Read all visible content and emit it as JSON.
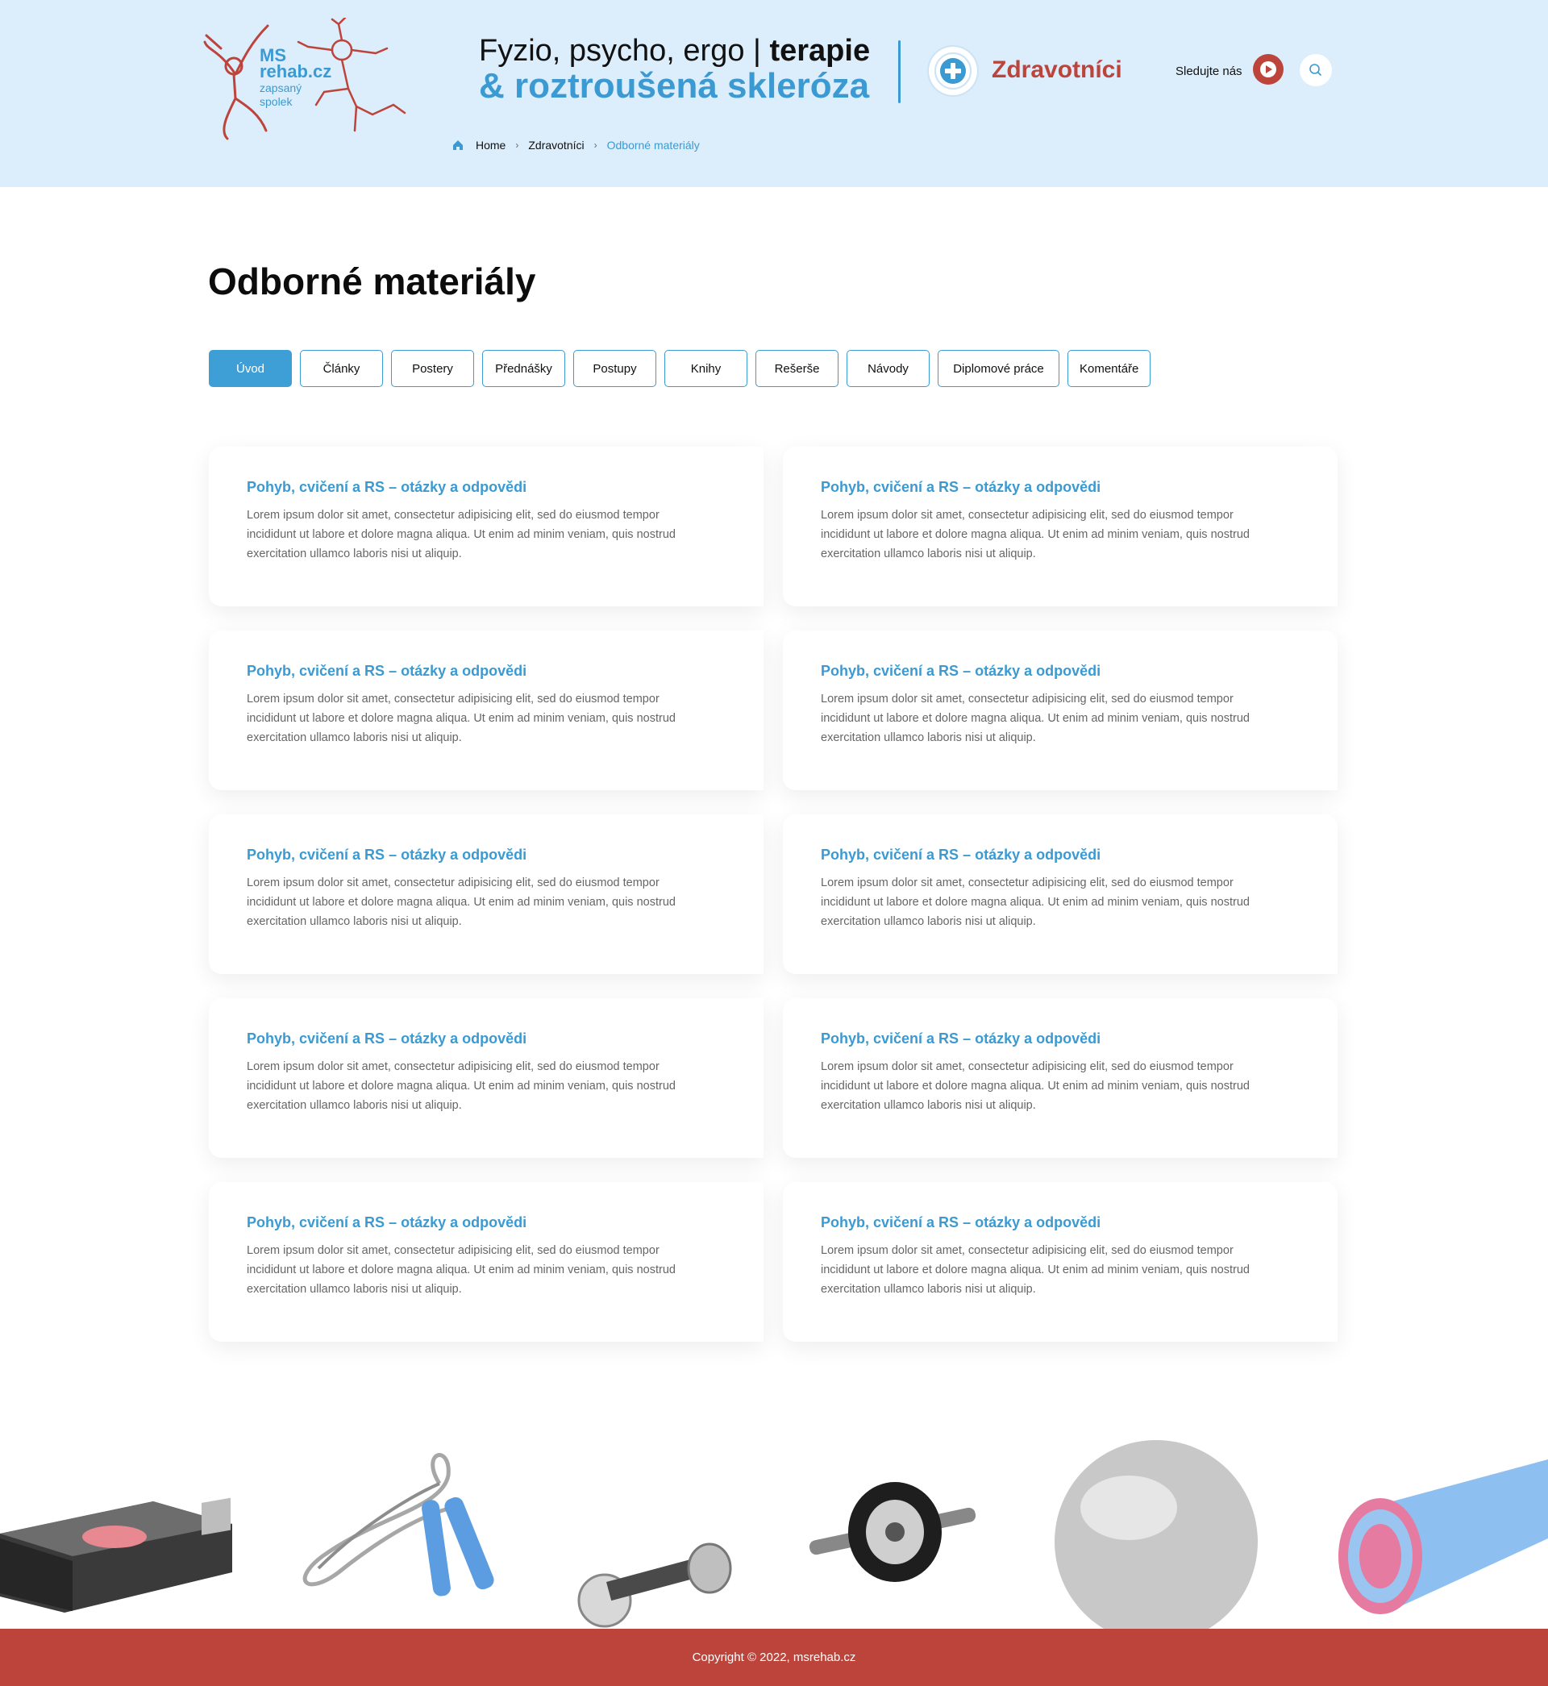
{
  "header": {
    "logo": {
      "line1": "MS",
      "line2": "rehab.cz",
      "line3": "zapsaný",
      "line4": "spolek"
    },
    "tagline": {
      "line1_regular": "Fyzio, psycho, ergo | ",
      "line1_bold": "terapie",
      "line2": "& roztroušená skleróza"
    },
    "section_name": "Zdravotníci",
    "follow_label": "Sledujte nás",
    "icons": {
      "youtube": "youtube-icon",
      "search": "search-icon",
      "cross": "medical-cross-icon",
      "home": "home-icon"
    }
  },
  "breadcrumb": {
    "items": [
      "Home",
      "Zdravotníci",
      "Odborné materiály"
    ]
  },
  "main": {
    "title": "Odborné materiály",
    "tabs": [
      {
        "label": "Úvod",
        "active": true
      },
      {
        "label": "Články",
        "active": false
      },
      {
        "label": "Postery",
        "active": false
      },
      {
        "label": "Přednášky",
        "active": false
      },
      {
        "label": "Postupy",
        "active": false
      },
      {
        "label": "Knihy",
        "active": false
      },
      {
        "label": "Rešerše",
        "active": false
      },
      {
        "label": "Návody",
        "active": false
      },
      {
        "label": "Diplomové práce",
        "active": false
      },
      {
        "label": "Komentáře",
        "active": false
      }
    ],
    "cards": [
      {
        "title": "Pohyb, cvičení a RS – otázky a odpovědi",
        "text": "Lorem ipsum dolor sit amet, consectetur adipisicing elit, sed do eiusmod tempor incididunt ut labore et dolore magna aliqua. Ut enim ad minim veniam, quis nostrud exercitation ullamco laboris nisi ut aliquip."
      },
      {
        "title": "Pohyb, cvičení a RS – otázky a odpovědi",
        "text": "Lorem ipsum dolor sit amet, consectetur adipisicing elit, sed do eiusmod tempor incididunt ut labore et dolore magna aliqua. Ut enim ad minim veniam, quis nostrud exercitation ullamco laboris nisi ut aliquip."
      },
      {
        "title": "Pohyb, cvičení a RS – otázky a odpovědi",
        "text": "Lorem ipsum dolor sit amet, consectetur adipisicing elit, sed do eiusmod tempor incididunt ut labore et dolore magna aliqua. Ut enim ad minim veniam, quis nostrud exercitation ullamco laboris nisi ut aliquip."
      },
      {
        "title": "Pohyb, cvičení a RS – otázky a odpovědi",
        "text": "Lorem ipsum dolor sit amet, consectetur adipisicing elit, sed do eiusmod tempor incididunt ut labore et dolore magna aliqua. Ut enim ad minim veniam, quis nostrud exercitation ullamco laboris nisi ut aliquip."
      },
      {
        "title": "Pohyb, cvičení a RS – otázky a odpovědi",
        "text": "Lorem ipsum dolor sit amet, consectetur adipisicing elit, sed do eiusmod tempor incididunt ut labore et dolore magna aliqua. Ut enim ad minim veniam, quis nostrud exercitation ullamco laboris nisi ut aliquip."
      },
      {
        "title": "Pohyb, cvičení a RS – otázky a odpovědi",
        "text": "Lorem ipsum dolor sit amet, consectetur adipisicing elit, sed do eiusmod tempor incididunt ut labore et dolore magna aliqua. Ut enim ad minim veniam, quis nostrud exercitation ullamco laboris nisi ut aliquip."
      },
      {
        "title": "Pohyb, cvičení a RS – otázky a odpovědi",
        "text": "Lorem ipsum dolor sit amet, consectetur adipisicing elit, sed do eiusmod tempor incididunt ut labore et dolore magna aliqua. Ut enim ad minim veniam, quis nostrud exercitation ullamco laboris nisi ut aliquip."
      },
      {
        "title": "Pohyb, cvičení a RS – otázky a odpovědi",
        "text": "Lorem ipsum dolor sit amet, consectetur adipisicing elit, sed do eiusmod tempor incididunt ut labore et dolore magna aliqua. Ut enim ad minim veniam, quis nostrud exercitation ullamco laboris nisi ut aliquip."
      },
      {
        "title": "Pohyb, cvičení a RS – otázky a odpovědi",
        "text": "Lorem ipsum dolor sit amet, consectetur adipisicing elit, sed do eiusmod tempor incididunt ut labore et dolore magna aliqua. Ut enim ad minim veniam, quis nostrud exercitation ullamco laboris nisi ut aliquip."
      },
      {
        "title": "Pohyb, cvičení a RS – otázky a odpovědi",
        "text": "Lorem ipsum dolor sit amet, consectetur adipisicing elit, sed do eiusmod tempor incididunt ut labore et dolore magna aliqua. Ut enim ad minim veniam, quis nostrud exercitation ullamco laboris nisi ut aliquip."
      }
    ]
  },
  "footer": {
    "copyright": "Copyright © 2022, msrehab.cz"
  },
  "colors": {
    "accent_blue": "#3b9ad1",
    "brand_red": "#bc443b",
    "header_bg": "#dcedfb"
  }
}
